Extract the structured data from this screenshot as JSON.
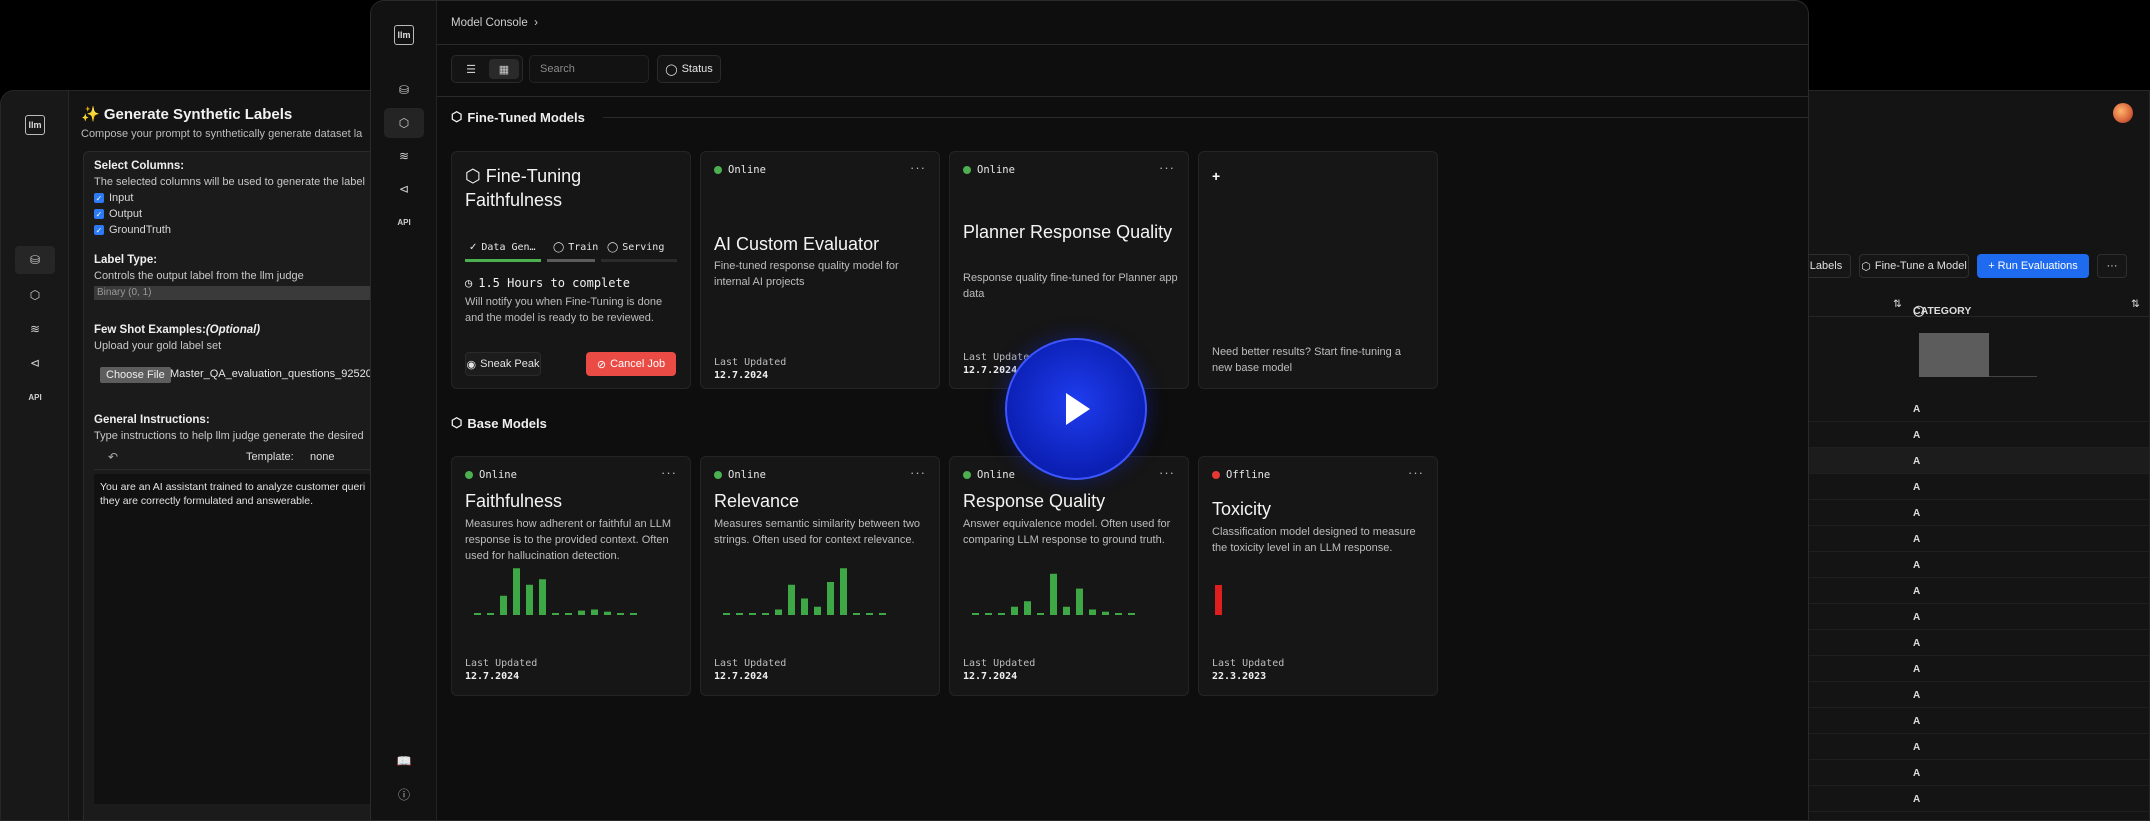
{
  "left_window": {
    "logo": "llm",
    "title": "Generate Synthetic Labels",
    "subtitle": "Compose your prompt to synthetically generate dataset la",
    "select_columns": {
      "label": "Select Columns:",
      "help": "The selected columns will be used to generate the label",
      "options": [
        "Input",
        "Output",
        "GroundTruth"
      ]
    },
    "label_type": {
      "label": "Label Type:",
      "help": "Controls the output label from the llm judge",
      "value": "Binary (0, 1)"
    },
    "few_shot": {
      "label": "Few Shot Examples:",
      "optional": "(Optional)",
      "help": "Upload your gold label set",
      "button": "Choose File",
      "filename": "Master_QA_evaluation_questions_9252024"
    },
    "general": {
      "label": "General Instructions:",
      "help": "Type instructions to help llm judge generate the desired",
      "template_label": "Template:",
      "template_value": "none",
      "prompt": "You are an AI assistant trained to analyze customer queri\nthey are correctly formulated and answerable."
    }
  },
  "right_window": {
    "buttons": {
      "labels": "Labels",
      "fine_tune": "Fine-Tune a Model",
      "run_evals": "+ Run Evaluations",
      "more": "···"
    },
    "column_header": "CATEGORY",
    "rows": [
      "A",
      "A",
      "A",
      "A",
      "A",
      "A",
      "A",
      "A",
      "A",
      "A",
      "A",
      "A",
      "A",
      "A",
      "A",
      "A"
    ]
  },
  "main": {
    "logo": "llm",
    "breadcrumb": "Model Console",
    "search_placeholder": "Search",
    "status_filter": "Status",
    "fine_tuned_section": "Fine-Tuned Models",
    "base_section": "Base Models",
    "fine_tuning_card": {
      "title": "Fine-Tuning Faithfulness",
      "steps": [
        "Data Gen…",
        "Train",
        "Serving"
      ],
      "eta": "1.5 Hours to complete",
      "note": "Will notify you when Fine-Tuning is done and the model is ready to be reviewed.",
      "peek": "Sneak Peak",
      "cancel": "Cancel Job"
    },
    "fine_tuned": [
      {
        "status": "Online",
        "title": "AI Custom Evaluator",
        "desc": "Fine-tuned response quality model for internal AI projects",
        "updated_label": "Last Updated",
        "updated": "12.7.2024"
      },
      {
        "status": "Online",
        "title": "Planner Response Quality",
        "desc": "Response quality fine-tuned for Planner app data",
        "updated_label": "Last Updated",
        "updated": "12.7.2024"
      }
    ],
    "new_card": {
      "plus": "+",
      "text": "Need better results? Start fine-tuning a new base model"
    },
    "base": [
      {
        "status": "Online",
        "title": "Faithfulness",
        "desc": "Measures how adherent or faithful an LLM response is to the provided context. Often used for hallucination detection.",
        "updated_label": "Last Updated",
        "updated": "12.7.2024",
        "bars": [
          0.03,
          0.03,
          0.35,
          0.85,
          0.55,
          0.65,
          0.03,
          0.03,
          0.08,
          0.1,
          0.06,
          0.03,
          0.03
        ]
      },
      {
        "status": "Online",
        "title": "Relevance",
        "desc": "Measures semantic similarity between two strings. Often used for context relevance.",
        "updated_label": "Last Updated",
        "updated": "12.7.2024",
        "bars": [
          0.03,
          0.03,
          0.03,
          0.03,
          0.1,
          0.55,
          0.3,
          0.15,
          0.6,
          0.85,
          0.03,
          0.03,
          0.03
        ]
      },
      {
        "status": "Online",
        "title": "Response Quality",
        "desc": "Answer equivalence model. Often used for comparing LLM response to ground truth.",
        "updated_label": "Last Updated",
        "updated": "12.7.2024",
        "bars": [
          0.03,
          0.03,
          0.03,
          0.15,
          0.25,
          0.03,
          0.75,
          0.15,
          0.48,
          0.1,
          0.06,
          0.03,
          0.03
        ]
      },
      {
        "status": "Offline",
        "title": "Toxicity",
        "desc": "Classification model designed to measure the toxicity level in an LLM response.",
        "updated_label": "Last Updated",
        "updated": "22.3.2023",
        "bars": [
          0.75
        ]
      }
    ]
  },
  "colors": {
    "online": "#4caf50",
    "offline": "#e53935",
    "accent_blue": "#1f6bf0",
    "cancel_red": "#ea4b45",
    "bar_green": "#3fa846",
    "bar_red": "#e01e1e"
  }
}
